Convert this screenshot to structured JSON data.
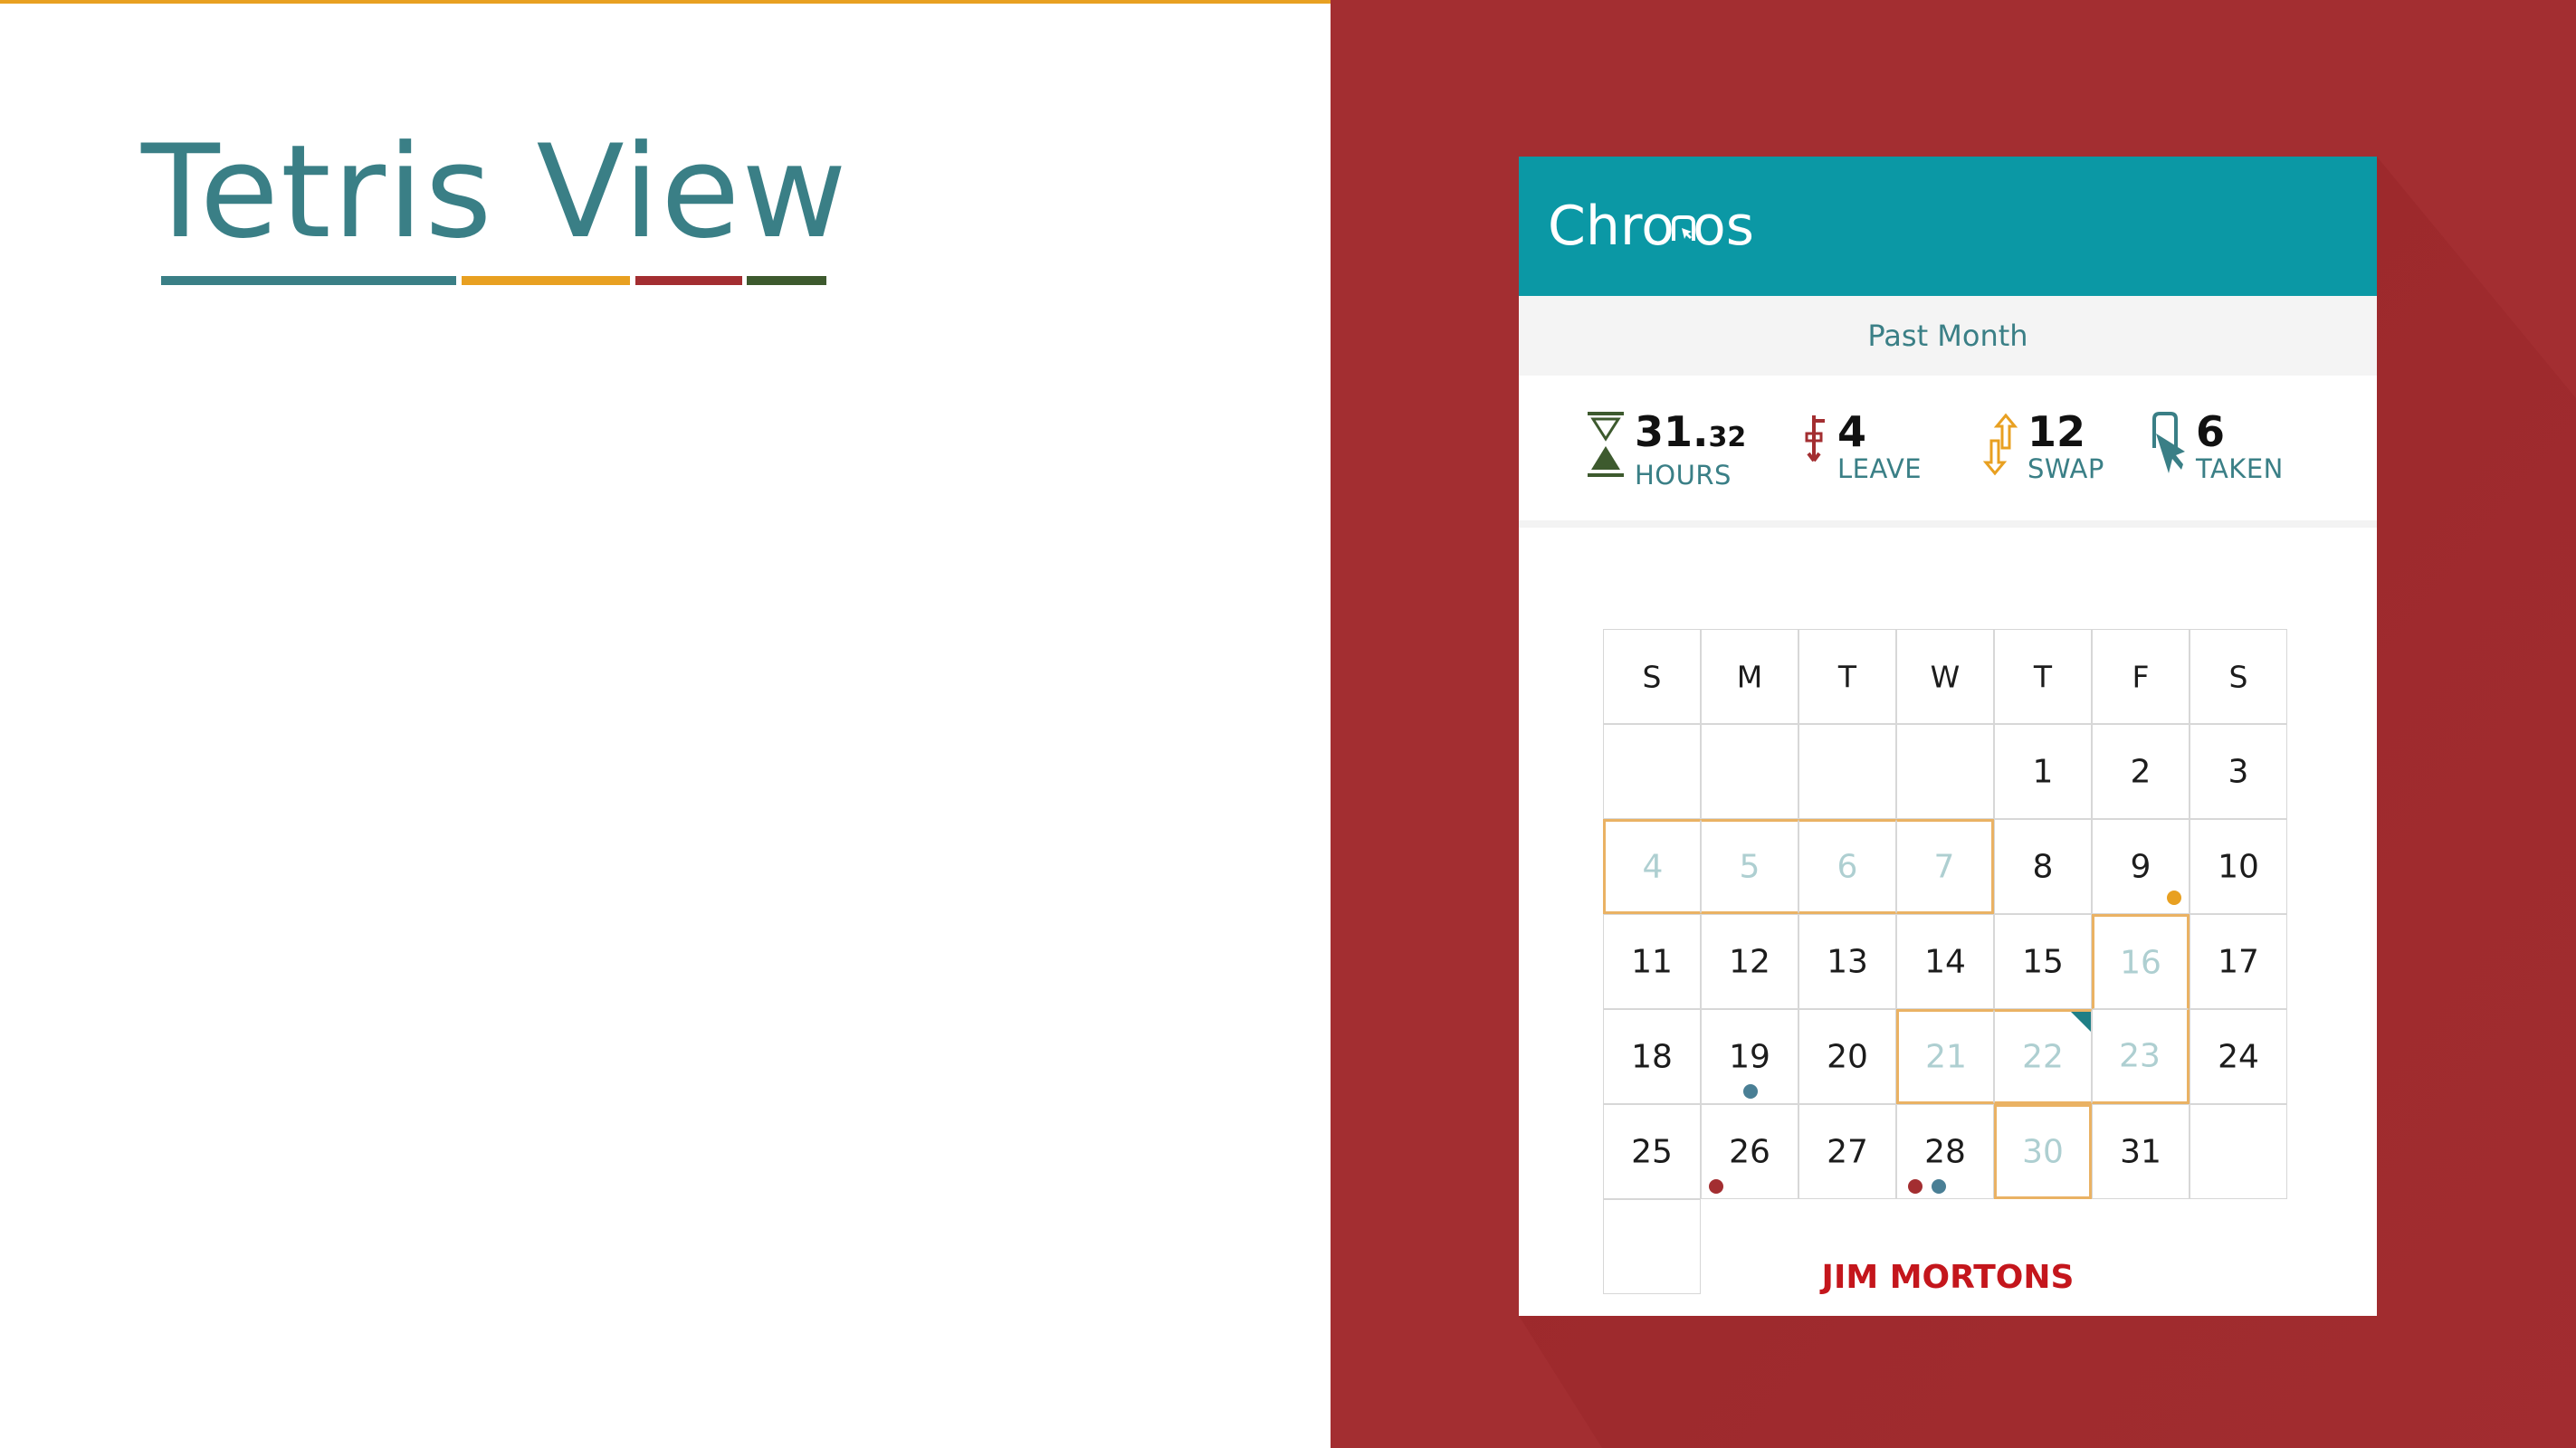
{
  "slide": {
    "title": "Tetris View",
    "underline_colors": [
      "#3a7f86",
      "#e8a021",
      "#a32e31",
      "#3d5a2e"
    ]
  },
  "app": {
    "name": "Chronos",
    "name_left": "Chro",
    "name_right": "os",
    "cursor_icon": "cursor-n-icon",
    "header_color": "#0b98a5",
    "filter_label": "Past Month",
    "stats": [
      {
        "icon": "hourglass-icon",
        "value": "31.",
        "value_small": "32",
        "label": "HOURS",
        "color": "#3d5a2e"
      },
      {
        "icon": "leave-arrow-icon",
        "value": "4",
        "value_small": "",
        "label": "LEAVE",
        "color": "#a32e31"
      },
      {
        "icon": "swap-arrows-icon",
        "value": "12",
        "value_small": "",
        "label": "SWAP",
        "color": "#e8a021"
      },
      {
        "icon": "taken-cursor-icon",
        "value": "6",
        "value_small": "",
        "label": "TAKEN",
        "color": "#3a7f86"
      }
    ],
    "calendar": {
      "weekdays": [
        "S",
        "M",
        "T",
        "W",
        "T",
        "F",
        "S"
      ],
      "weeks": [
        [
          "",
          "",
          "",
          "",
          "1",
          "2",
          "3"
        ],
        [
          "4",
          "5",
          "6",
          "7",
          "8",
          "9",
          "10"
        ],
        [
          "11",
          "12",
          "13",
          "14",
          "15",
          "16",
          "17"
        ],
        [
          "18",
          "19",
          "20",
          "21",
          "22",
          "23",
          "24"
        ],
        [
          "25",
          "26",
          "27",
          "28",
          "30",
          "31",
          ""
        ],
        [
          "",
          null,
          null,
          null,
          null,
          null,
          null
        ]
      ],
      "muted_days": [
        "4",
        "5",
        "6",
        "7",
        "16",
        "21",
        "22",
        "23",
        "30"
      ],
      "highlight_color": "#eab264",
      "dots": [
        {
          "day": "9",
          "color": "#e8a021"
        },
        {
          "day": "19",
          "color": "#4a7f95"
        },
        {
          "day": "26",
          "color": "#a32e31"
        },
        {
          "day": "28",
          "color": "#a32e31"
        },
        {
          "day": "28",
          "color": "#4a7f95"
        }
      ],
      "flag_day": "22",
      "flag_color": "#1f7f86"
    },
    "employee_name": "JIM MORTONS"
  }
}
